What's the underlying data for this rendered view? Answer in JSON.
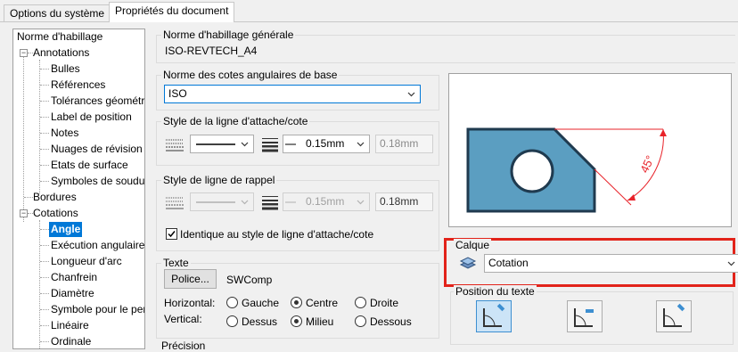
{
  "tabs": [
    {
      "label": "Options du système"
    },
    {
      "label": "Propriétés du document"
    }
  ],
  "tree": {
    "root": "Norme d'habillage",
    "annotations": "Annotations",
    "annotation_items": [
      "Bulles",
      "Références",
      "Tolérances géométr",
      "Label de position",
      "Notes",
      "Nuages de révision",
      "Etats de surface",
      "Symboles de soudu"
    ],
    "bordures": "Bordures",
    "cotations": "Cotations",
    "cotation_items": [
      "Angle",
      "Exécution angulaire",
      "Longueur d'arc",
      "Chanfrein",
      "Diamètre",
      "Symbole pour le per",
      "Linéaire",
      "Ordinale"
    ],
    "selected": "Angle"
  },
  "norme": {
    "title": "Norme d'habillage générale",
    "value": "ISO-REVTECH_A4"
  },
  "angular_std": {
    "title": "Norme des cotes angulaires de base",
    "value": "ISO"
  },
  "leader_style": {
    "title": "Style de la ligne d'attache/cote",
    "thickness": "0.15mm",
    "custom": "0.18mm"
  },
  "extension_style": {
    "title": "Style de ligne de rappel",
    "thickness": "0.15mm",
    "custom": "0.18mm",
    "same_label": "Identique au style de ligne d'attache/cote",
    "same_checked": true
  },
  "text": {
    "title": "Texte",
    "font_button": "Police...",
    "font_name": "SWComp",
    "horizontal_label": "Horizontal:",
    "vertical_label": "Vertical:",
    "h_options": [
      "Gauche",
      "Centre",
      "Droite"
    ],
    "v_options": [
      "Dessus",
      "Milieu",
      "Dessous"
    ],
    "h_selected": "Centre",
    "v_selected": "Milieu"
  },
  "preview": {
    "dimension_text": "45°",
    "part_color": "#5b9ec1",
    "dim_color": "#e8232a"
  },
  "layer": {
    "title": "Calque",
    "value": "Cotation"
  },
  "text_position": {
    "title": "Position du texte"
  },
  "cut_label": "Précision"
}
